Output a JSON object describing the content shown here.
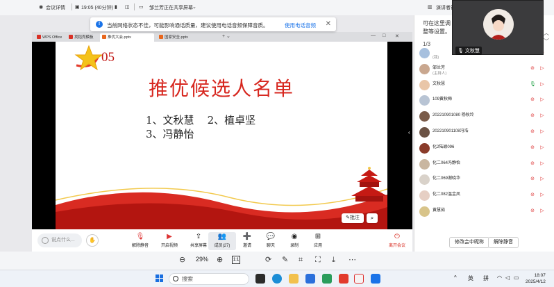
{
  "topbar": {
    "meeting_details": "会议详情",
    "time": "19:05 (40分钟)",
    "sharing_status": "邹兰芳正在共享屏幕",
    "presenter_view": "演讲者视"
  },
  "warning": {
    "text": "当前网络状态不佳，可能影响通话质量，建议使用电话音频保障音质。",
    "link": "使用电话音频"
  },
  "browser_tabs": [
    {
      "label": "WPS Office",
      "color": "#d93025"
    },
    {
      "label": "找稻壳模板",
      "color": "#d93025"
    },
    {
      "label": "推优大会.pptx",
      "color": "#e8661c"
    },
    {
      "label": "国家安全.pptx",
      "color": "#e8661c"
    }
  ],
  "slide": {
    "number": "05",
    "title": "推优候选人名单",
    "line1": "1、文秋慧    2、植卓坚",
    "line2": "3、冯静怡",
    "annotate": "批注"
  },
  "panel": {
    "hint": "可在这里调整等设置。",
    "pager": "1/3",
    "video_name": "文秋慧",
    "participants": [
      {
        "name": "",
        "sub": "(我)",
        "color": "#a7c0de"
      },
      {
        "name": "邹兰芳",
        "sub": "(主持人)",
        "color": "#c9a78f"
      },
      {
        "name": "文秋慧",
        "sub": "",
        "color": "#e9c6a8"
      },
      {
        "name": "109黄秋梅",
        "sub": "",
        "color": "#b8c4d4"
      },
      {
        "name": "2022109010​80 杨秋玲",
        "sub": "",
        "color": "#7a5c4a"
      },
      {
        "name": "202210901108冯浩",
        "sub": "",
        "color": "#6b5244"
      },
      {
        "name": "化2陆颖096",
        "sub": "",
        "color": "#8a3b2a"
      },
      {
        "name": "化二064冯静怡",
        "sub": "",
        "color": "#c9b6a0"
      },
      {
        "name": "化二069谢晓华",
        "sub": "",
        "color": "#d9d2ca"
      },
      {
        "name": "化二082温金凤",
        "sub": "",
        "color": "#e6cfc4"
      },
      {
        "name": "黄慧茹",
        "sub": "",
        "color": "#d8c48a"
      }
    ],
    "rename_button": "修改会中昵称",
    "unmute_button": "解除静音"
  },
  "toolbar": {
    "speak_placeholder": "说点什么...",
    "items": [
      {
        "label": "解除静音",
        "icon": "mic-off-icon"
      },
      {
        "label": "开启视频",
        "icon": "video-off-icon"
      },
      {
        "label": "共享屏幕",
        "icon": "share-screen-icon"
      },
      {
        "label": "成员(27)",
        "icon": "members-icon"
      },
      {
        "label": "邀请",
        "icon": "invite-icon"
      },
      {
        "label": "聊天",
        "icon": "chat-icon"
      },
      {
        "label": "录制",
        "icon": "record-icon"
      },
      {
        "label": "应用",
        "icon": "apps-icon"
      }
    ],
    "leave": "离开会议"
  },
  "viewer": {
    "zoom": "29%",
    "page_box": "1:1"
  },
  "taskbar": {
    "search": "搜索",
    "lang": "英",
    "ime": "拼",
    "time": "18:07",
    "date": "2025/4/12"
  }
}
